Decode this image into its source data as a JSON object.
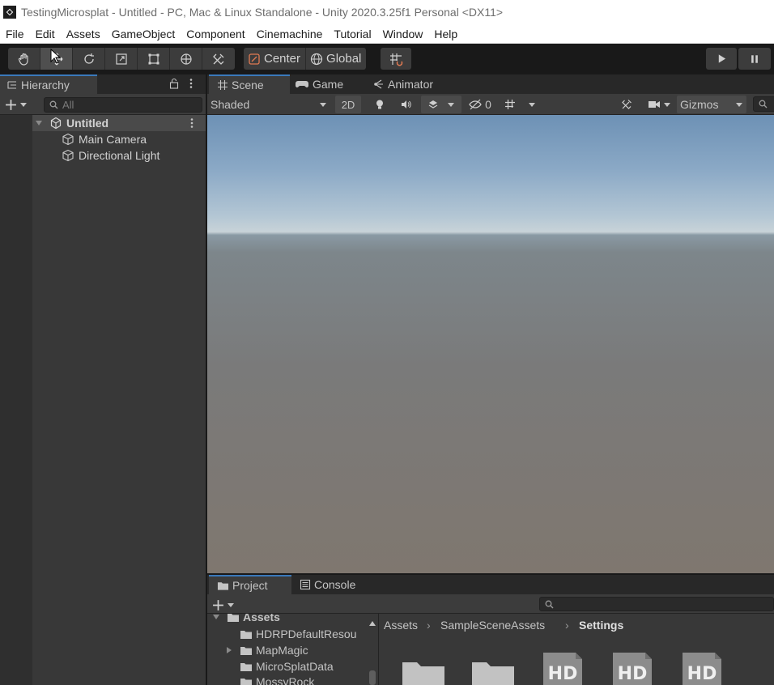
{
  "window": {
    "title": "TestingMicrosplat - Untitled - PC, Mac & Linux Standalone - Unity 2020.3.25f1 Personal <DX11>"
  },
  "menu": [
    "File",
    "Edit",
    "Assets",
    "GameObject",
    "Component",
    "Cinemachine",
    "Tutorial",
    "Window",
    "Help"
  ],
  "toolbar": {
    "pivot_label": "Center",
    "space_label": "Global"
  },
  "hierarchy": {
    "tab_label": "Hierarchy",
    "search_placeholder": "All",
    "scene_name": "Untitled",
    "objects": [
      "Main Camera",
      "Directional Light"
    ]
  },
  "scene": {
    "tabs": [
      "Scene",
      "Game",
      "Animator"
    ],
    "shading_mode": "Shaded",
    "mode_2d": "2D",
    "hidden_count": "0",
    "gizmos_label": "Gizmos"
  },
  "project": {
    "tabs": [
      "Project",
      "Console"
    ],
    "tree": [
      {
        "label": "Assets",
        "expanded": true
      },
      {
        "label": "HDRPDefaultResou"
      },
      {
        "label": "MapMagic",
        "collapsed": true
      },
      {
        "label": "MicroSplatData"
      },
      {
        "label": "MossyRock"
      }
    ],
    "breadcrumb": [
      "Assets",
      "SampleSceneAssets",
      "Settings"
    ],
    "asset_badge": "HD"
  },
  "colors": {
    "accent_tab": "#3a79bb",
    "toolbar_bg": "#191919",
    "panel_bg": "#383838"
  }
}
